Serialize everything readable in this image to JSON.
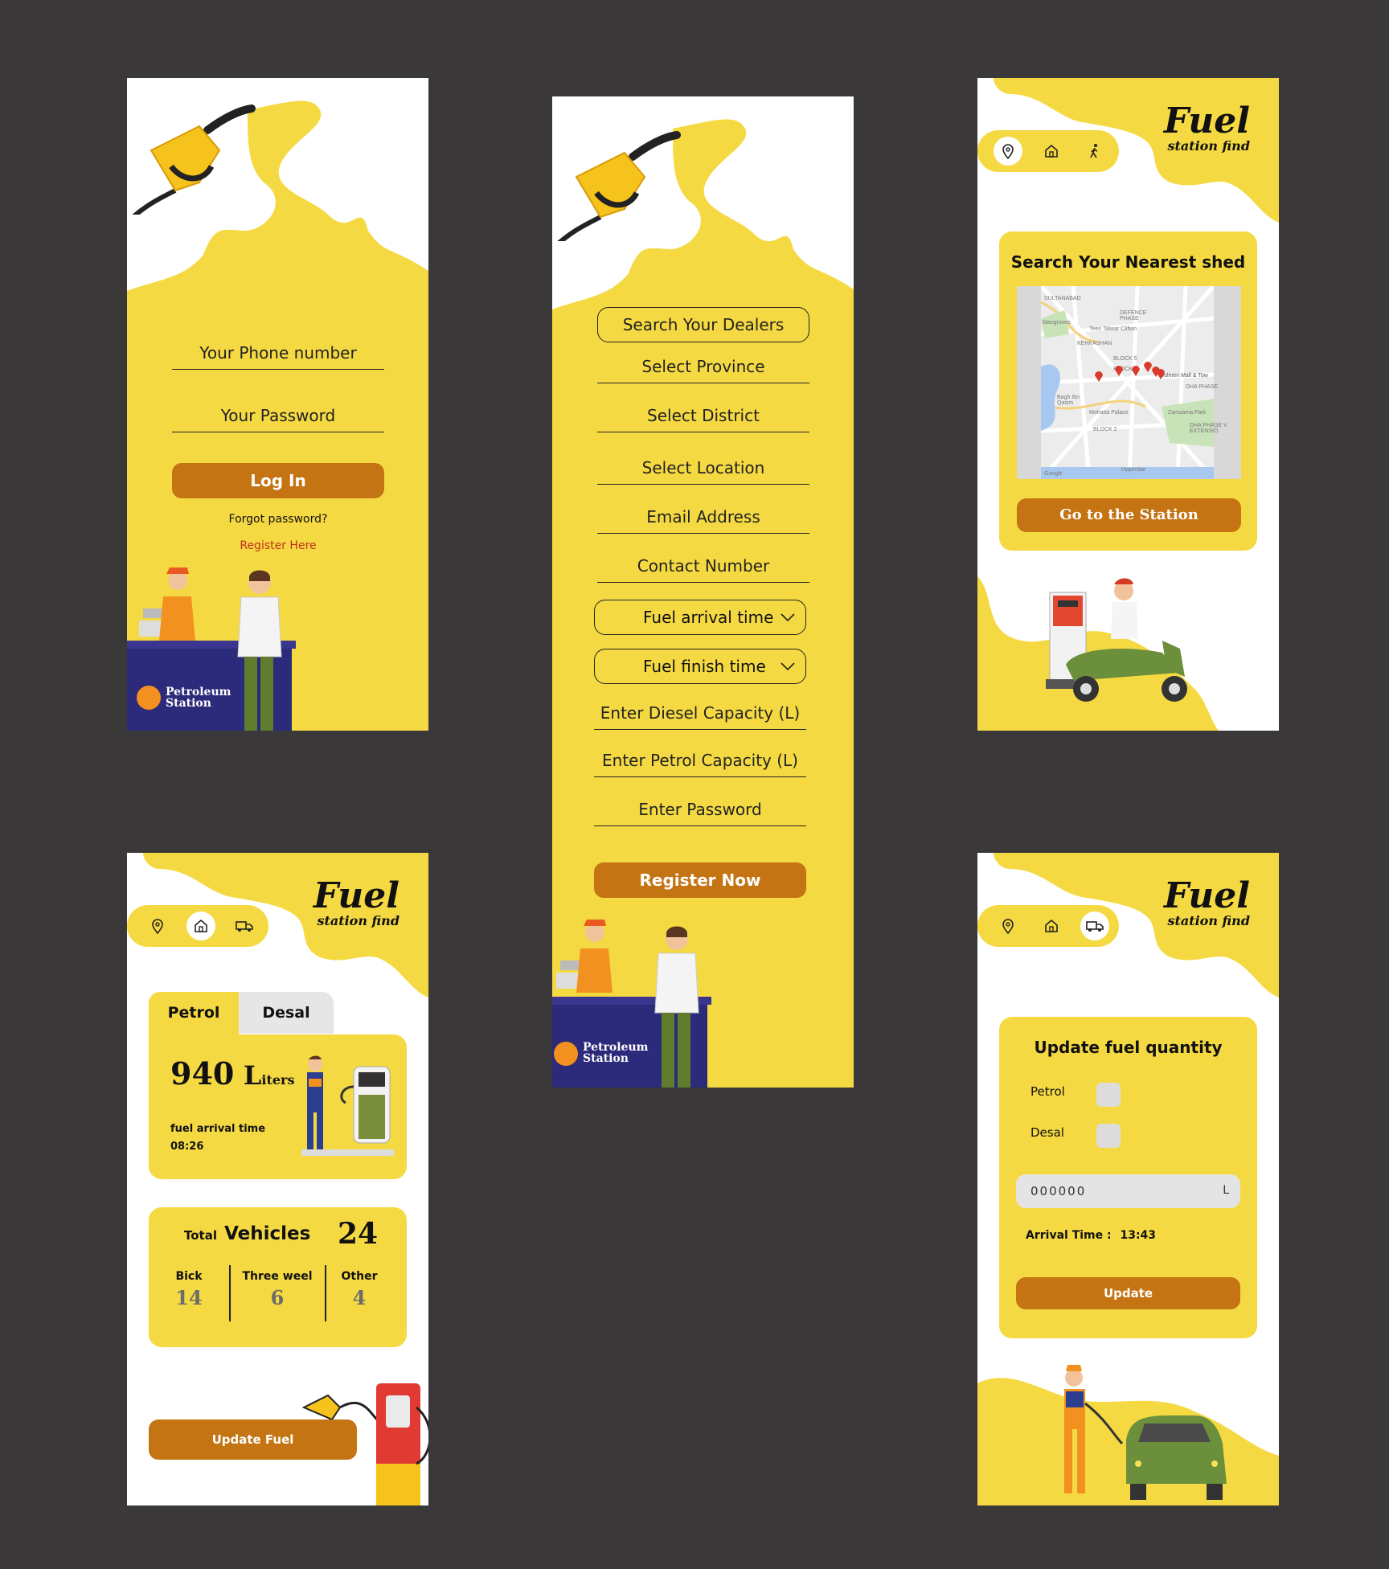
{
  "login": {
    "phone_label": "Your Phone number",
    "password_label": "Your Password",
    "login_button": "Log In",
    "forgot": "Forgot password?",
    "register": "Register Here",
    "station_sign_line1": "Petroleum",
    "station_sign_line2": "Station"
  },
  "register": {
    "search_dealers": "Search Your Dealers",
    "select_province": "Select Province",
    "select_district": "Select District",
    "select_location": "Select Location",
    "email": "Email Address",
    "contact": "Contact Number",
    "fuel_arrival": "Fuel arrival time",
    "fuel_finish": "Fuel finish time",
    "diesel_capacity": "Enter Diesel Capacity (L)",
    "petrol_capacity": "Enter Petrol Capacity (L)",
    "password": "Enter Password",
    "register_button": "Register Now",
    "station_sign_line1": "Petroleum",
    "station_sign_line2": "Station"
  },
  "brand": {
    "title": "Fuel",
    "subtitle": "station find"
  },
  "map_screen": {
    "heading": "Search Your Nearest shed",
    "button": "Go to the Station",
    "map_labels": [
      "DEFENCE PHASE",
      "Teen Talwar Clifton",
      "KEHKASHAN",
      "BLOCK 5",
      "BLOCK 4",
      "Dolmen Mall & Tow",
      "Mohatta Palace",
      "Zamzama Park",
      "BLOCK 2",
      "DHA PHASE V EXTENSIO",
      "Hyperstar",
      "Google",
      "Mangroves",
      "Bagh Ibn Qasim",
      "DHA PHASE",
      "SULTANABAD"
    ]
  },
  "home_screen": {
    "tabs": [
      "Petrol",
      "Desal"
    ],
    "liters_value": "940",
    "liters_unit_big": "L",
    "liters_unit_small": "iters",
    "arrival_label": "fuel arrival time",
    "arrival_time": "08:26",
    "total_small": "Total",
    "total_big": "Vehicles",
    "total_value": "24",
    "categories": [
      {
        "label": "Bick",
        "value": "14"
      },
      {
        "label": "Three weel",
        "value": "6"
      },
      {
        "label": "Other",
        "value": "4"
      }
    ],
    "update_button": "Update Fuel"
  },
  "update_screen": {
    "heading": "Update fuel quantity",
    "petrol_label": "Petrol",
    "desal_label": "Desal",
    "quantity_value": "000000",
    "quantity_unit": "L",
    "arrival_label": "Arrival Time :",
    "arrival_value": "13:43",
    "update_button": "Update"
  },
  "icons": {
    "nav": [
      "location-pin-icon",
      "home-icon",
      "walk-icon",
      "truck-icon"
    ],
    "dropdown": "chevron-down-icon"
  },
  "colors": {
    "background": "#3a3839",
    "yellow": "#f5d942",
    "button": "#c47412",
    "register_link": "#c0301a",
    "counter_navy": "#2c2a7a"
  }
}
